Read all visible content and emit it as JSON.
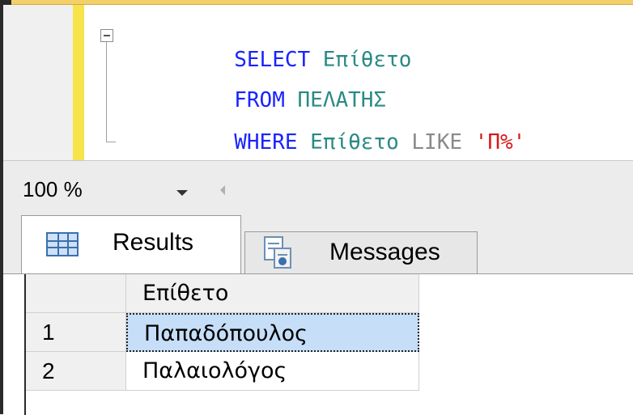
{
  "editor": {
    "lines": [
      {
        "tokens": [
          {
            "text": "SELECT",
            "cls": "kw"
          },
          {
            "text": " Επίθετο",
            "cls": "id"
          }
        ]
      },
      {
        "tokens": [
          {
            "text": "FROM",
            "cls": "kw"
          },
          {
            "text": " ΠΕΛΑΤΗΣ",
            "cls": "id"
          }
        ]
      },
      {
        "tokens": [
          {
            "text": "WHERE",
            "cls": "kw"
          },
          {
            "text": " Επίθετο",
            "cls": "id"
          },
          {
            "text": " LIKE ",
            "cls": "op"
          },
          {
            "text": "'Π%'",
            "cls": "str"
          }
        ]
      }
    ]
  },
  "zoom": {
    "value": "100 %"
  },
  "tabs": {
    "results_label": "Results",
    "messages_label": "Messages"
  },
  "results": {
    "column": "Επίθετο",
    "rows": [
      {
        "num": "1",
        "value": "Παπαδόπουλος"
      },
      {
        "num": "2",
        "value": "Παλαιολόγος"
      }
    ]
  },
  "icons": {
    "fold": "collapse-icon",
    "results": "grid-icon",
    "messages": "messages-icon",
    "zoom": "chevron-down-icon",
    "scroll": "scroll-left-icon"
  },
  "colors": {
    "keyword": "#1a23ff",
    "identifier": "#2a8a84",
    "operator": "#8a8a8a",
    "string": "#d81818",
    "selection": "#c6def8"
  }
}
